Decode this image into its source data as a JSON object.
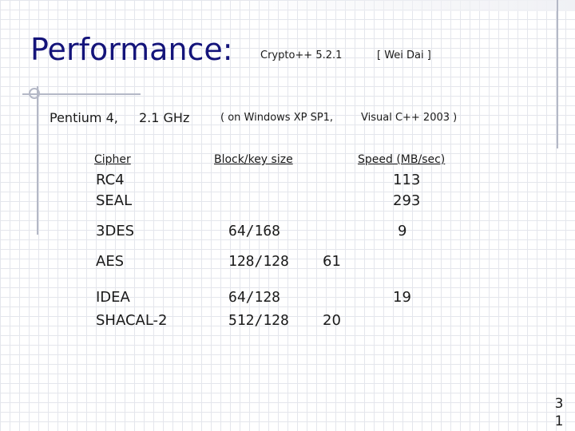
{
  "slide": {
    "title": "Performance:",
    "header_lib": "Crypto++  5.2.1",
    "header_author": "[ Wei Dai ]",
    "platform_cpu": "Pentium 4,",
    "platform_freq": "2.1 GHz",
    "platform_os": "( on Windows XP SP1,",
    "platform_compiler": "Visual C++ 2003 )",
    "page_number": [
      "3",
      "1"
    ]
  },
  "table": {
    "headers": {
      "cipher": "Cipher",
      "block": "Block/key size",
      "speed": "Speed   (MB/sec)"
    },
    "rows": [
      {
        "cipher": "RC4",
        "block": "",
        "speed": "113",
        "speed2": ""
      },
      {
        "cipher": "SEAL",
        "block": "",
        "speed": "293",
        "speed2": ""
      },
      {
        "cipher": "3DES",
        "block": "64/168",
        "speed": "9",
        "speed2": ""
      },
      {
        "cipher": "AES",
        "block": "128/128",
        "speed": "",
        "speed2": "61"
      },
      {
        "cipher": "IDEA",
        "block": "64/128",
        "speed": "19",
        "speed2": ""
      },
      {
        "cipher": "SHACAL-2",
        "block": "512/128",
        "speed": "",
        "speed2": "20"
      }
    ]
  }
}
